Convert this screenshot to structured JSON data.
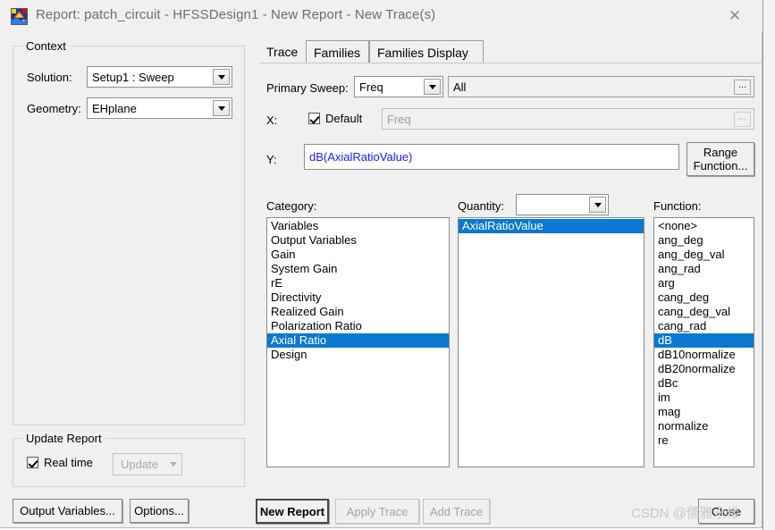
{
  "window": {
    "title": "Report: patch_circuit - HFSSDesign1 - New Report - New Trace(s)",
    "app_icon": "hfss-icon",
    "close_label": "✕"
  },
  "context": {
    "legend": "Context",
    "solution_label": "Solution:",
    "solution_value": "Setup1 : Sweep",
    "geometry_label": "Geometry:",
    "geometry_value": "EHplane"
  },
  "update_report": {
    "legend": "Update Report",
    "realtime_label": "Real time",
    "update_button": "Update"
  },
  "left_buttons": {
    "output_variables": "Output Variables...",
    "options": "Options..."
  },
  "tabs": [
    {
      "label": "Trace",
      "selected": true
    },
    {
      "label": "Families",
      "selected": false
    },
    {
      "label": "Families Display",
      "selected": false
    }
  ],
  "trace": {
    "primary_sweep_label": "Primary Sweep:",
    "primary_sweep_value": "Freq",
    "primary_sweep_range": "All",
    "range_dots": "...",
    "x_label": "X:",
    "x_default_label": "Default",
    "x_value": "Freq",
    "x_dots": "...",
    "y_label": "Y:",
    "y_value": "dB(AxialRatioValue)",
    "range_function_button": "Range\nFunction...",
    "category_label": "Category:",
    "categories": [
      "Variables",
      "Output Variables",
      "Gain",
      "System Gain",
      "rE",
      "Directivity",
      "Realized Gain",
      "Polarization Ratio",
      "Axial Ratio",
      "Design"
    ],
    "category_selected": "Axial Ratio",
    "quantity_label": "Quantity:",
    "quantity_value": "",
    "quantities": [
      "AxialRatioValue"
    ],
    "quantity_selected": "AxialRatioValue",
    "function_label": "Function:",
    "functions": [
      "<none>",
      "ang_deg",
      "ang_deg_val",
      "ang_rad",
      "arg",
      "cang_deg",
      "cang_deg_val",
      "cang_rad",
      "dB",
      "dB10normalize",
      "dB20normalize",
      "dBc",
      "im",
      "mag",
      "normalize",
      "re"
    ],
    "function_selected": "dB"
  },
  "bottom_buttons": {
    "new_report": "New Report",
    "apply_trace": "Apply Trace",
    "add_trace": "Add Trace",
    "close": "Close"
  },
  "watermark": "CSDN @儒雅永缘",
  "colors": {
    "selection_blue": "#0b78d1",
    "expression_blue": "#1a1aff",
    "dialog_face": "#f0f0f0"
  }
}
